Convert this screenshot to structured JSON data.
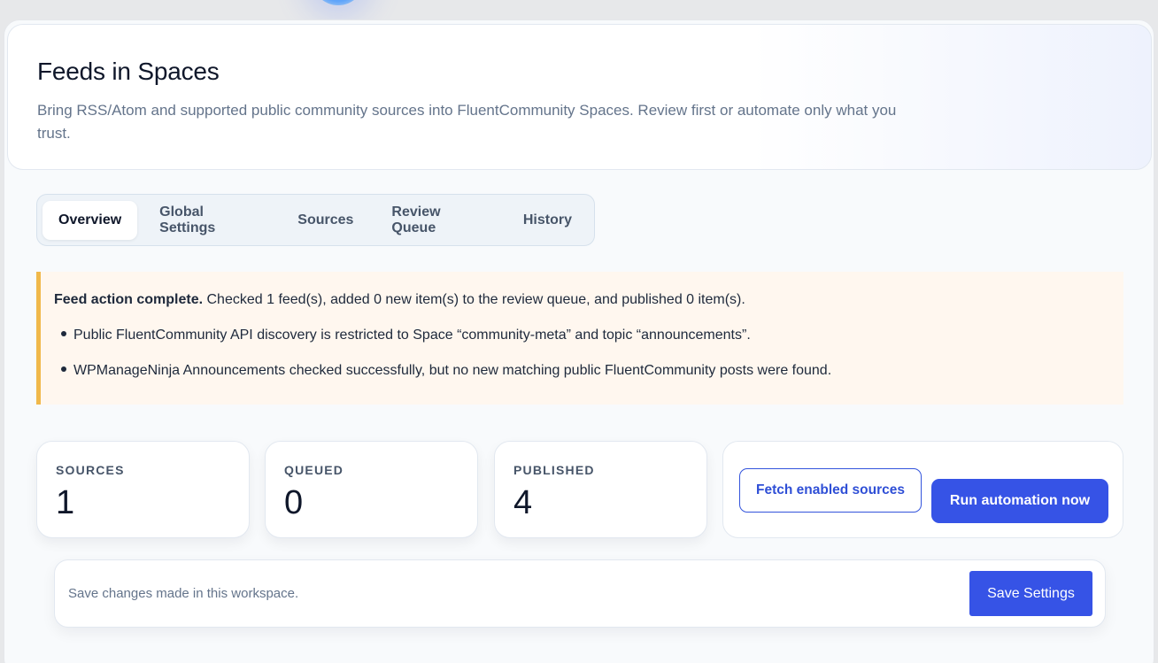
{
  "header": {
    "title": "Feeds in Spaces",
    "description": "Bring RSS/Atom and supported public community sources into FluentCommunity Spaces. Review first or automate only what you trust."
  },
  "tabs": [
    {
      "label": "Overview",
      "active": true
    },
    {
      "label": "Global Settings",
      "active": false
    },
    {
      "label": "Sources",
      "active": false
    },
    {
      "label": "Review Queue",
      "active": false
    },
    {
      "label": "History",
      "active": false
    }
  ],
  "notice": {
    "title": "Feed action complete.",
    "message": "Checked 1 feed(s), added 0 new item(s) to the review queue, and published 0 item(s).",
    "items": [
      "Public FluentCommunity API discovery is restricted to Space “community-meta” and topic “announcements”.",
      "WPManageNinja Announcements checked successfully, but no new matching public FluentCommunity posts were found."
    ]
  },
  "stats": [
    {
      "label": "SOURCES",
      "value": "1"
    },
    {
      "label": "QUEUED",
      "value": "0"
    },
    {
      "label": "PUBLISHED",
      "value": "4"
    }
  ],
  "actions": {
    "fetch_label": "Fetch enabled sources",
    "run_label": "Run automation now"
  },
  "savebar": {
    "hint": "Save changes made in this workspace.",
    "save_label": "Save Settings"
  },
  "colors": {
    "accent": "#3653e6",
    "notice_bg": "#fff7ef",
    "notice_border": "#f0b84a"
  }
}
